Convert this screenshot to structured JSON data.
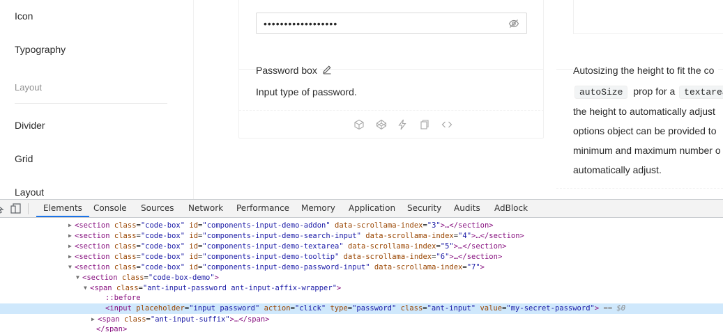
{
  "sidebar": {
    "items_top": [
      {
        "label": "Icon"
      },
      {
        "label": "Typography"
      }
    ],
    "group_label": "Layout",
    "items_bottom": [
      {
        "label": "Divider"
      },
      {
        "label": "Grid"
      },
      {
        "label": "Layout"
      }
    ]
  },
  "demo": {
    "password_dots": "••••••••••••••••••",
    "meta_title": "Password box",
    "meta_desc": "Input type of password.",
    "action_icons": [
      "codesandbox-icon",
      "codepen-icon",
      "stackblitz-icon",
      "copy-icon",
      "code-expand-icon"
    ]
  },
  "right_demo": {
    "title": "Autosizing the height to fit the co",
    "line1_code_a": "autoSize",
    "line1_text": "prop for a",
    "line1_code_b": "textarea",
    "line2": "the height to automatically adjust",
    "line3": "options object can be provided to",
    "line4": "minimum and maximum number o",
    "line5": "automatically adjust."
  },
  "devtools": {
    "tabs": [
      "Elements",
      "Console",
      "Sources",
      "Network",
      "Performance",
      "Memory",
      "Application",
      "Security",
      "Audits",
      "AdBlock"
    ],
    "active_tab": "Elements",
    "lines": [
      {
        "indent": 107,
        "tri": "▶",
        "html": "<section class=\"code-box\" id=\"components-input-demo-addon\" data-scrollama-index=\"3\">…</section>"
      },
      {
        "indent": 107,
        "tri": "▶",
        "html": "<section class=\"code-box\" id=\"components-input-demo-search-input\" data-scrollama-index=\"4\">…</section>"
      },
      {
        "indent": 107,
        "tri": "▶",
        "html": "<section class=\"code-box\" id=\"components-input-demo-textarea\" data-scrollama-index=\"5\">…</section>"
      },
      {
        "indent": 107,
        "tri": "▶",
        "html": "<section class=\"code-box\" id=\"components-input-demo-tooltip\" data-scrollama-index=\"6\">…</section>"
      },
      {
        "indent": 107,
        "tri": "▼",
        "html": "<section class=\"code-box\" id=\"components-input-demo-password-input\" data-scrollama-index=\"7\">"
      },
      {
        "indent": 118,
        "tri": "▼",
        "html": "<section class=\"code-box-demo\">"
      },
      {
        "indent": 129,
        "tri": "▼",
        "html": "<span class=\"ant-input-password ant-input-affix-wrapper\">"
      },
      {
        "indent": 151,
        "tri": "",
        "html": "::before"
      },
      {
        "indent": 151,
        "tri": "",
        "html": "<input placeholder=\"input password\" action=\"click\" type=\"password\" class=\"ant-input\" value=\"my-secret-password\">",
        "selected": true,
        "suffix": "== $0"
      },
      {
        "indent": 140,
        "tri": "▶",
        "html": "<span class=\"ant-input-suffix\">…</span>"
      },
      {
        "indent": 138,
        "tri": "",
        "html": "</span>"
      }
    ]
  }
}
